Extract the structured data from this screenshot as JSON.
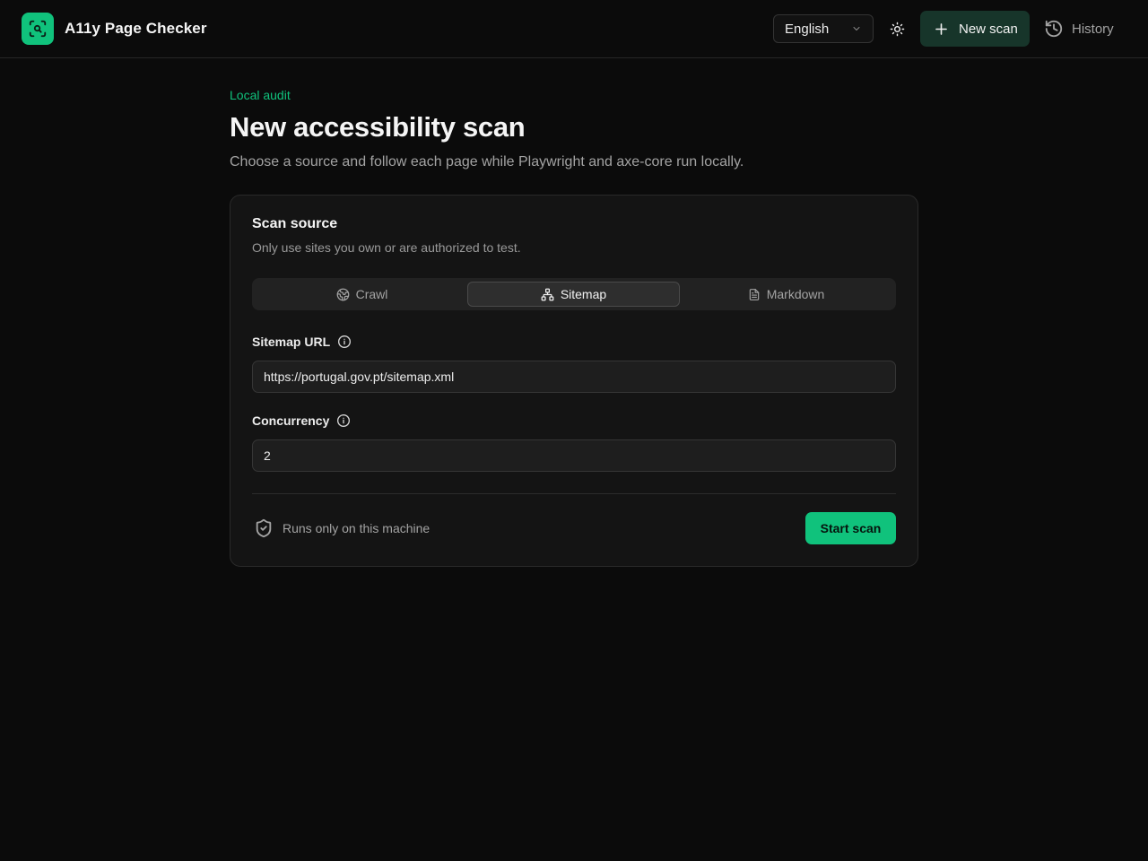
{
  "app": {
    "name": "A11y Page Checker"
  },
  "header": {
    "language": "English",
    "new_scan_label": "New scan",
    "history_label": "History",
    "theme_icon": "sun-icon"
  },
  "page": {
    "eyebrow": "Local audit",
    "title": "New accessibility scan",
    "subtitle": "Choose a source and follow each page while Playwright and axe-core run locally."
  },
  "card": {
    "title": "Scan source",
    "subtitle": "Only use sites you own or are authorized to test.",
    "tabs": [
      {
        "label": "Crawl",
        "icon": "globe-icon",
        "active": false
      },
      {
        "label": "Sitemap",
        "icon": "sitemap-icon",
        "active": true
      },
      {
        "label": "Markdown",
        "icon": "document-icon",
        "active": false
      }
    ],
    "sitemap_url": {
      "label": "Sitemap URL",
      "value": "https://portugal.gov.pt/sitemap.xml"
    },
    "concurrency": {
      "label": "Concurrency",
      "value": "2"
    },
    "footer_note": "Runs only on this machine",
    "start_label": "Start scan"
  },
  "colors": {
    "accent": "#10c27c",
    "background": "#0b0b0b",
    "card": "#141414",
    "new_scan_bg": "#17352a"
  }
}
